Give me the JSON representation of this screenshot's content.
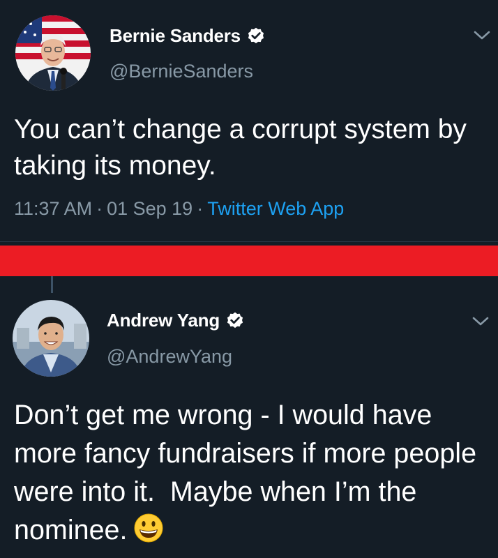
{
  "tweets": [
    {
      "display_name": "Bernie Sanders",
      "handle": "@BernieSanders",
      "verified": true,
      "text": "You can’t change a corrupt system by taking its money.",
      "time": "11:37 AM",
      "date": "01 Sep 19",
      "source": "Twitter Web App"
    },
    {
      "display_name": "Andrew Yang",
      "handle": "@AndrewYang",
      "verified": true,
      "text": "Don’t get me wrong - I would have more fancy fundraisers if more people were into it.  Maybe when I’m the nominee.",
      "emoji": "grinning-face"
    }
  ],
  "meta_separator": "·",
  "colors": {
    "background": "#141d26",
    "secondary_text": "#8899a6",
    "link": "#1da1f2",
    "verified_badge": "#ffffff",
    "banner": "#ec1c24"
  },
  "icons": [
    "verified-badge-icon",
    "chevron-down-icon",
    "grinning-emoji-icon"
  ]
}
